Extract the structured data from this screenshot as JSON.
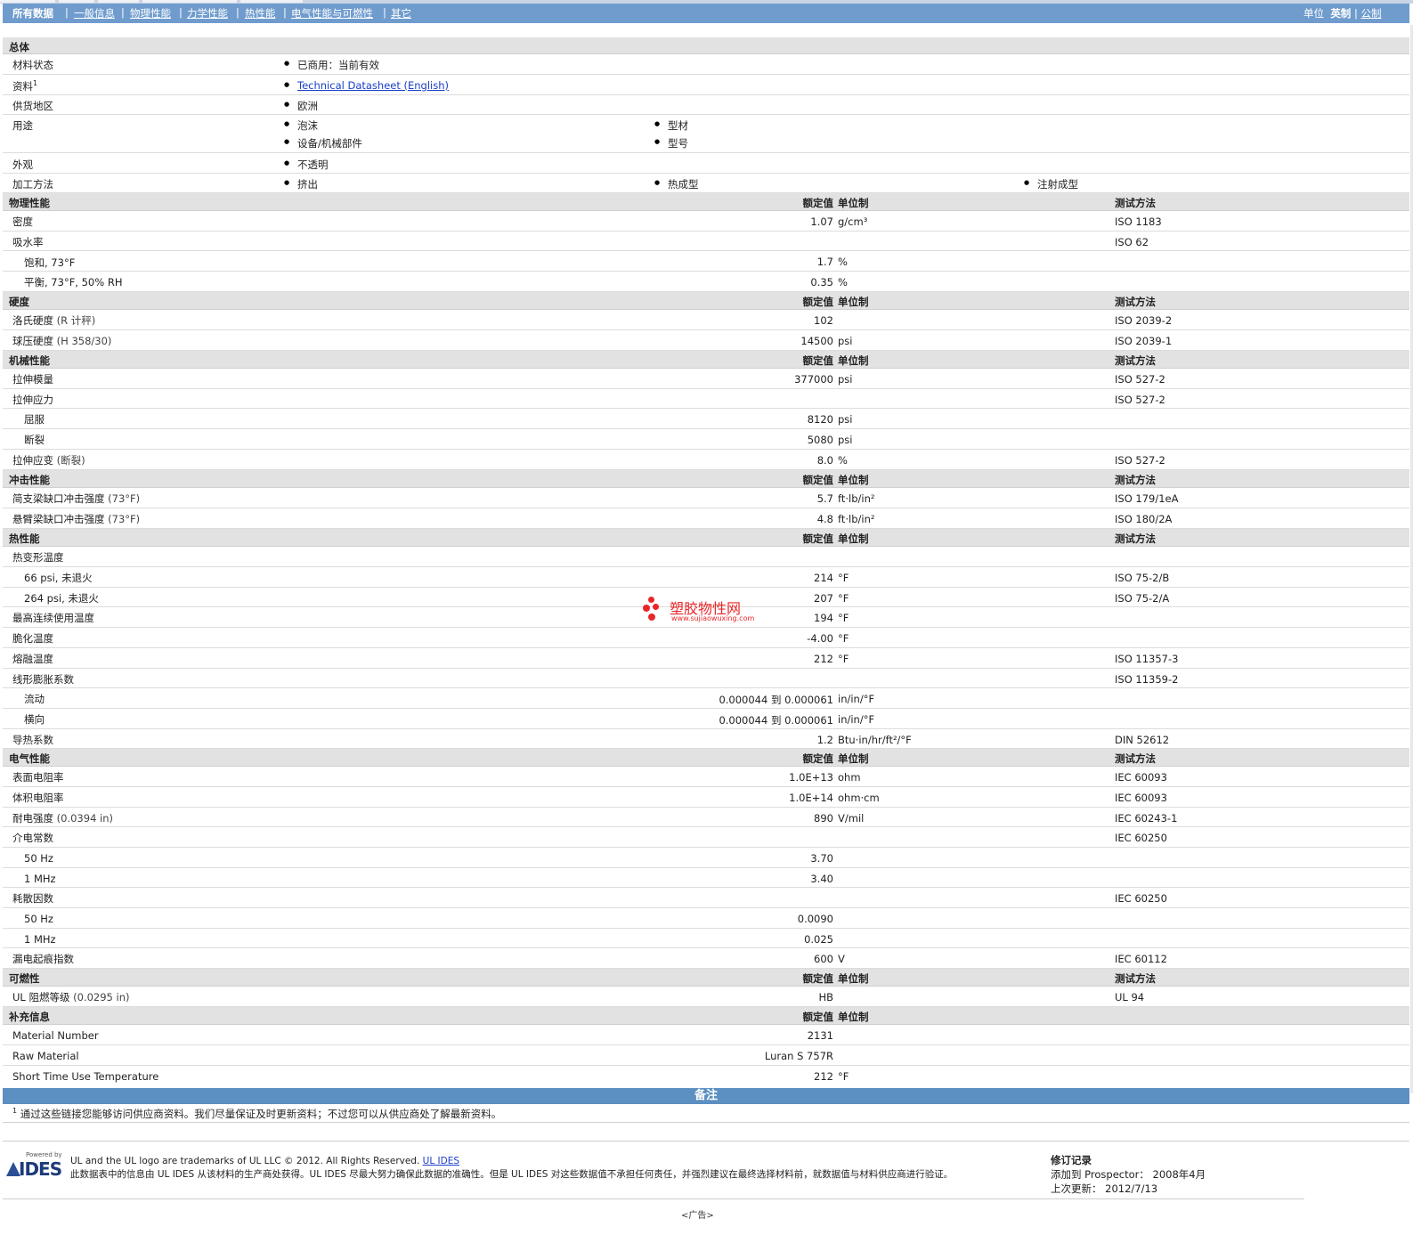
{
  "nav": {
    "tabs": [
      "所有数据",
      "一般信息",
      "物理性能",
      "力学性能",
      "热性能",
      "电气性能与可燃性",
      "其它"
    ],
    "unit_label": "单位",
    "unit_english": "英制",
    "unit_metric": "公制"
  },
  "general": {
    "title": "总体",
    "status_label": "材料状态",
    "status_value": "已商用：当前有效",
    "source_label": "资料",
    "source_sup": "1",
    "source_link": "Technical Datasheet (English)",
    "region_label": "供货地区",
    "region_value": "欧洲",
    "uses_label": "用途",
    "uses": [
      "泡沫",
      "型材",
      "设备/机械部件",
      "型号"
    ],
    "appearance_label": "外观",
    "appearance_value": "不透明",
    "processing_label": "加工方法",
    "processing": [
      "挤出",
      "热成型",
      "注射成型"
    ]
  },
  "headers": {
    "value": "额定值",
    "unit": "单位制",
    "test": "测试方法"
  },
  "sections": {
    "physical": "物理性能",
    "hardness": "硬度",
    "mechanical": "机械性能",
    "impact": "冲击性能",
    "thermal": "热性能",
    "electrical": "电气性能",
    "flammability": "可燃性",
    "supplemental": "补充信息"
  },
  "rows": {
    "density": {
      "label": "密度",
      "value": "1.07",
      "unit": "g/cm³",
      "test": "ISO 1183"
    },
    "water_absorption": {
      "label": "吸水率",
      "test": "ISO 62"
    },
    "wa_saturation": {
      "label": "饱和, 73°F",
      "value": "1.7",
      "unit": "%"
    },
    "wa_equilibrium": {
      "label": "平衡, 73°F, 50% RH",
      "value": "0.35",
      "unit": "%"
    },
    "rockwell": {
      "label": "洛氏硬度",
      "cond": "(R 计秤)",
      "value": "102",
      "test": "ISO 2039-2"
    },
    "ball": {
      "label": "球压硬度",
      "cond": "(H 358/30)",
      "value": "14500",
      "unit": "psi",
      "test": "ISO 2039-1"
    },
    "tensile_modulus": {
      "label": "拉伸模量",
      "value": "377000",
      "unit": "psi",
      "test": "ISO 527-2"
    },
    "tensile_stress": {
      "label": "拉伸应力",
      "test": "ISO 527-2"
    },
    "ts_yield": {
      "label": "屈服",
      "value": "8120",
      "unit": "psi"
    },
    "ts_break": {
      "label": "断裂",
      "value": "5080",
      "unit": "psi"
    },
    "tensile_strain": {
      "label": "拉伸应变",
      "cond": "(断裂)",
      "value": "8.0",
      "unit": "%",
      "test": "ISO 527-2"
    },
    "charpy": {
      "label": "简支梁缺口冲击强度",
      "cond": "(73°F)",
      "value": "5.7",
      "unit": "ft·lb/in²",
      "test": "ISO 179/1eA"
    },
    "izod": {
      "label": "悬臂梁缺口冲击强度",
      "cond": "(73°F)",
      "value": "4.8",
      "unit": "ft·lb/in²",
      "test": "ISO 180/2A"
    },
    "hdt": {
      "label": "热变形温度"
    },
    "hdt_66": {
      "label": "66 psi, 未退火",
      "value": "214",
      "unit": "°F",
      "test": "ISO 75-2/B"
    },
    "hdt_264": {
      "label": "264 psi, 未退火",
      "value": "207",
      "unit": "°F",
      "test": "ISO 75-2/A"
    },
    "max_service": {
      "label": "最高连续使用温度",
      "value": "194",
      "unit": "°F"
    },
    "brittle": {
      "label": "脆化温度",
      "value": "-4.00",
      "unit": "°F"
    },
    "melt": {
      "label": "熔融温度",
      "value": "212",
      "unit": "°F",
      "test": "ISO 11357-3"
    },
    "clte": {
      "label": "线形膨胀系数",
      "test": "ISO 11359-2"
    },
    "clte_flow": {
      "label": "流动",
      "value": "0.000044 到  0.000061",
      "unit": "in/in/°F"
    },
    "clte_trans": {
      "label": "横向",
      "value": "0.000044 到  0.000061",
      "unit": "in/in/°F"
    },
    "conductivity": {
      "label": "导热系数",
      "value": "1.2",
      "unit": "Btu·in/hr/ft²/°F",
      "test": "DIN 52612"
    },
    "surface_res": {
      "label": "表面电阻率",
      "value": "1.0E+13",
      "unit": "ohm",
      "test": "IEC 60093"
    },
    "volume_res": {
      "label": "体积电阻率",
      "value": "1.0E+14",
      "unit": "ohm·cm",
      "test": "IEC 60093"
    },
    "dielectric_strength": {
      "label": "耐电强度",
      "cond": "(0.0394 in)",
      "value": "890",
      "unit": "V/mil",
      "test": "IEC 60243-1"
    },
    "dielectric_const": {
      "label": "介电常数",
      "test": "IEC 60250"
    },
    "dc_50": {
      "label": "50 Hz",
      "value": "3.70"
    },
    "dc_1m": {
      "label": "1 MHz",
      "value": "3.40"
    },
    "dissipation": {
      "label": "耗散因数",
      "test": "IEC 60250"
    },
    "df_50": {
      "label": "50 Hz",
      "value": "0.0090"
    },
    "df_1m": {
      "label": "1 MHz",
      "value": "0.025"
    },
    "cti": {
      "label": "漏电起痕指数",
      "value": "600",
      "unit": "V",
      "test": "IEC 60112"
    },
    "ul94": {
      "label": "UL 阻燃等级",
      "cond": "(0.0295 in)",
      "value": "HB",
      "test": "UL 94"
    },
    "material_number": {
      "label": "Material Number",
      "value": "2131"
    },
    "raw_material": {
      "label": "Raw Material",
      "value": "Luran S 757R"
    },
    "short_time": {
      "label": "Short Time Use Temperature",
      "value": "212",
      "unit": "°F"
    }
  },
  "remarks": {
    "title": "备注",
    "note_sup": "1",
    "note": "通过这些链接您能够访问供应商资料。我们尽量保证及时更新资料；不过您可以从供应商处了解最新资料。"
  },
  "footer": {
    "logo_small": "Powered by",
    "logo": "IDES",
    "line1": "UL and the UL logo are trademarks of UL LLC © 2012. All Rights Reserved.",
    "line1_link": "UL IDES",
    "line2": "此数据表中的信息由 UL IDES 从该材料的生产商处获得。UL IDES 尽最大努力确保此数据的准确性。但是 UL IDES 对这些数据值不承担任何责任，并强烈建议在最终选择材料前，就数据值与材料供应商进行验证。",
    "rev_title": "修订记录",
    "rev_added": "添加到 Prospector： 2008年4月",
    "rev_updated": "上次更新： 2012/7/13",
    "ad": "<广告>"
  },
  "watermark": {
    "name": "塑胶物性网",
    "url": "www.sujiaowuxing.com"
  }
}
